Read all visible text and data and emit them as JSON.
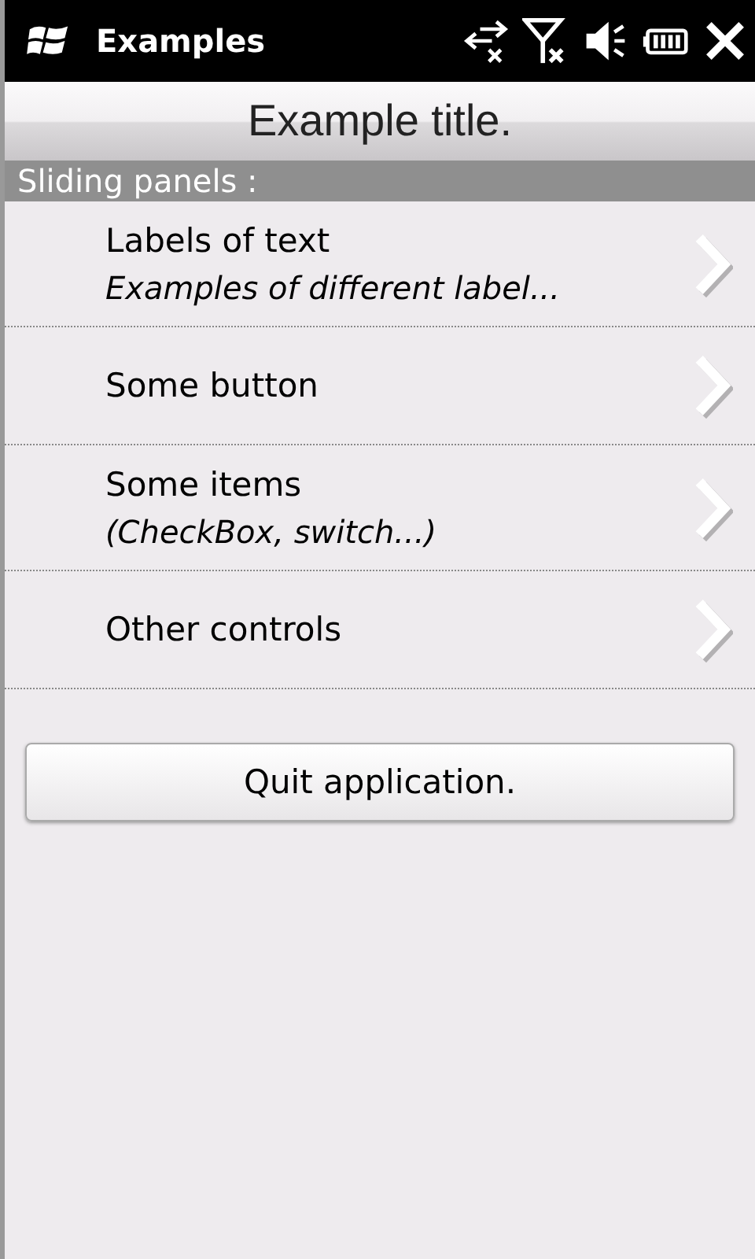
{
  "status_bar": {
    "title": "Examples"
  },
  "header": {
    "title": "Example title."
  },
  "section": {
    "title": "Sliding panels :"
  },
  "items": [
    {
      "label": "Labels of text",
      "subtitle": "Examples of different label..."
    },
    {
      "label": "Some button"
    },
    {
      "label": "Some items",
      "subtitle": "(CheckBox, switch...)"
    },
    {
      "label": "Other controls"
    }
  ],
  "button": {
    "label": "Quit application."
  }
}
